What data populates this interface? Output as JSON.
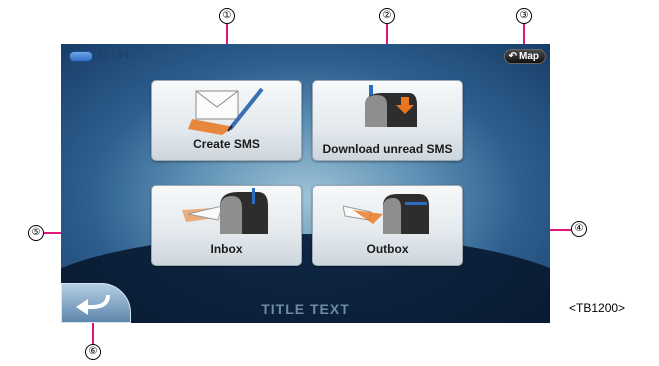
{
  "status": {
    "time": "12:34"
  },
  "map_button": {
    "label": "Map",
    "icon": "back-arrow-icon"
  },
  "tiles": [
    {
      "label": "Create SMS",
      "icon": "envelope-pen-icon"
    },
    {
      "label": "Download unread SMS",
      "icon": "mailbox-download-icon"
    },
    {
      "label": "Inbox",
      "icon": "mailbox-inbox-icon"
    },
    {
      "label": "Outbox",
      "icon": "mailbox-outbox-icon"
    }
  ],
  "back_button": {
    "icon": "return-arrow-icon"
  },
  "title_text": "TITLE TEXT",
  "callouts": [
    "①",
    "②",
    "③",
    "④",
    "⑤",
    "⑥"
  ],
  "figure_code": "<TB1200>",
  "colors": {
    "callout_line": "#e0167f",
    "screen_bg": "#2e5f8f"
  }
}
